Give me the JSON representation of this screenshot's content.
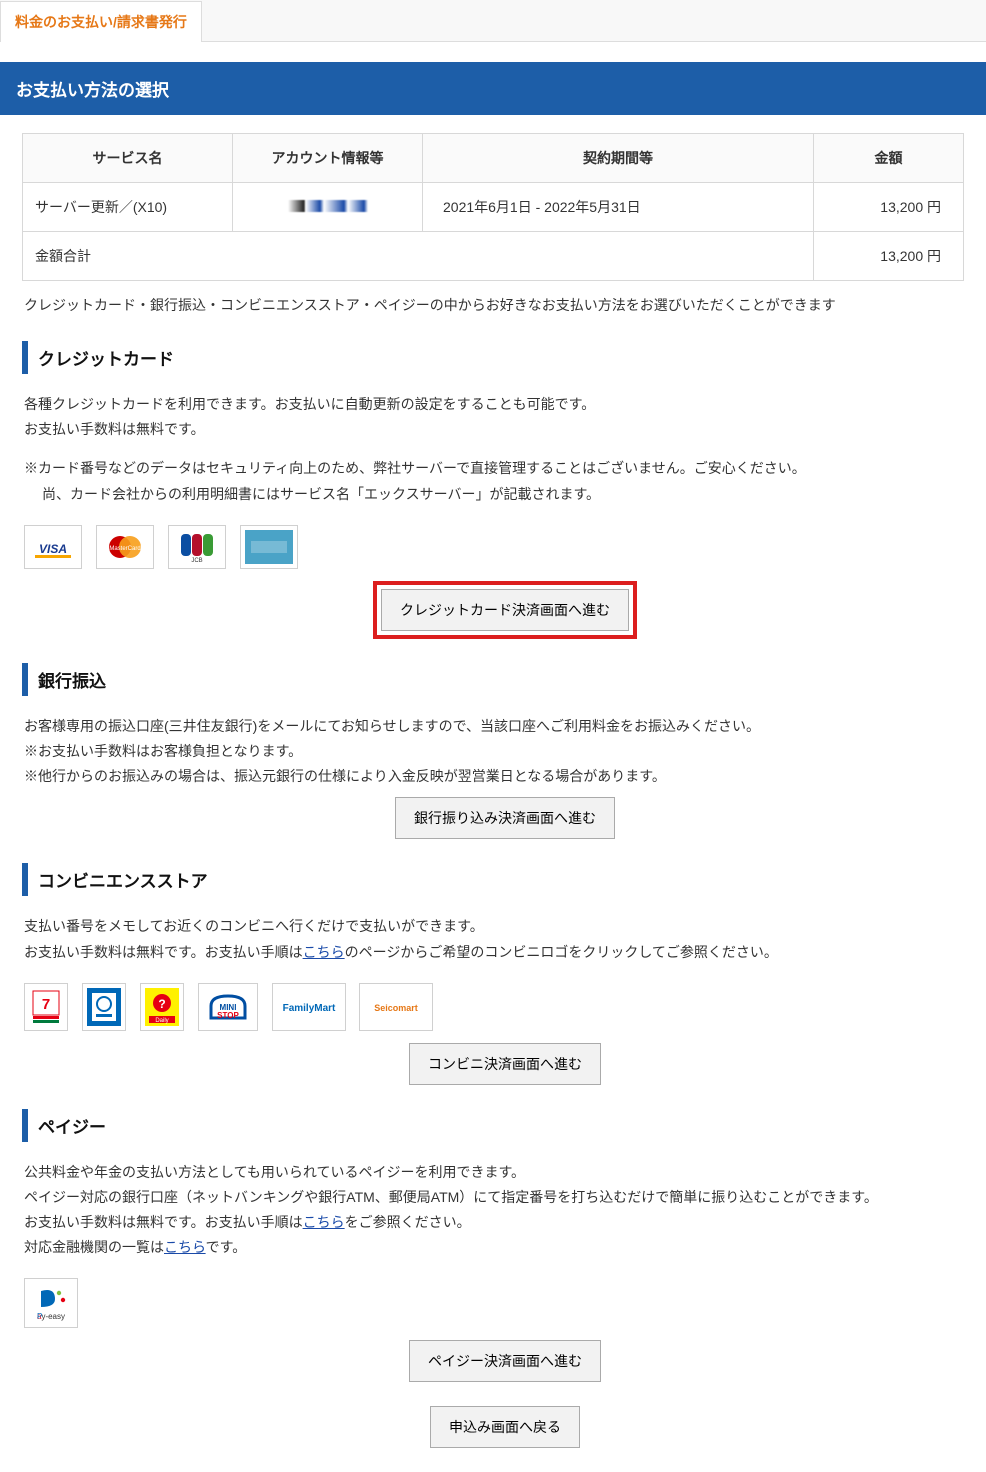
{
  "tab_label": "料金のお支払い/請求書発行",
  "section_title": "お支払い方法の選択",
  "table": {
    "headers": [
      "サービス名",
      "アカウント情報等",
      "契約期間等",
      "金額"
    ],
    "row": {
      "service": "サーバー更新／(X10)",
      "period": "2021年6月1日 - 2022年5月31日",
      "amount": "13,200 円"
    },
    "total_label": "金額合計",
    "total_amount": "13,200 円"
  },
  "intro": "クレジットカード・銀行振込・コンビニエンスストア・ペイジーの中からお好きなお支払い方法をお選びいただくことができます",
  "credit": {
    "title": "クレジットカード",
    "line1": "各種クレジットカードを利用できます。お支払いに自動更新の設定をすることも可能です。",
    "line2": "お支払い手数料は無料です。",
    "note1": "※カード番号などのデータはセキュリティ向上のため、弊社サーバーで直接管理することはございません。ご安心ください。",
    "note2": "尚、カード会社からの利用明細書にはサービス名「エックスサーバー」が記載されます。",
    "button": "クレジットカード決済画面へ進む"
  },
  "bank": {
    "title": "銀行振込",
    "line1": "お客様専用の振込口座(三井住友銀行)をメールにてお知らせしますので、当該口座へご利用料金をお振込みください。",
    "line2": "※お支払い手数料はお客様負担となります。",
    "line3": "※他行からのお振込みの場合は、振込元銀行の仕様により入金反映が翌営業日となる場合があります。",
    "button": "銀行振り込み決済画面へ進む"
  },
  "conv": {
    "title": "コンビニエンスストア",
    "line1": "支払い番号をメモしてお近くのコンビニへ行くだけで支払いができます。",
    "line2a": "お支払い手数料は無料です。お支払い手順は",
    "link": "こちら",
    "line2b": "のページからご希望のコンビニロゴをクリックしてご参照ください。",
    "button": "コンビニ決済画面へ進む"
  },
  "payeasy": {
    "title": "ペイジー",
    "line1": "公共料金や年金の支払い方法としても用いられているペイジーを利用できます。",
    "line2": "ペイジー対応の銀行口座（ネットバンキングや銀行ATM、郵便局ATM）にて指定番号を打ち込むだけで簡単に振り込むことができます。",
    "line3a": "お支払い手数料は無料です。お支払い手順は",
    "link1": "こちら",
    "line3b": "をご参照ください。",
    "line4a": "対応金融機関の一覧は",
    "link2": "こちら",
    "line4b": "です。",
    "button": "ペイジー決済画面へ進む"
  },
  "back_button": "申込み画面へ戻る"
}
